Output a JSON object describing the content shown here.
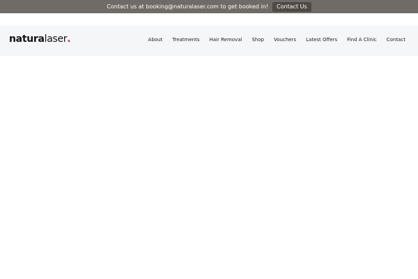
{
  "announcement": {
    "text": "Contact us at booking@naturalaser.com to get booked in!",
    "button_label": "Contact Us"
  },
  "logo": {
    "bold_part": "natura",
    "thin_part": "laser",
    "dot": "."
  },
  "nav": {
    "items": [
      "About",
      "Treatments",
      "Hair Removal",
      "Shop",
      "Vouchers",
      "Latest Offers",
      "Find A Clinic",
      "Contact"
    ]
  },
  "colors": {
    "topbar_bg": "#6f6b66",
    "header_bg": "#f5f6f8",
    "logo_dot": "#e0245e"
  }
}
